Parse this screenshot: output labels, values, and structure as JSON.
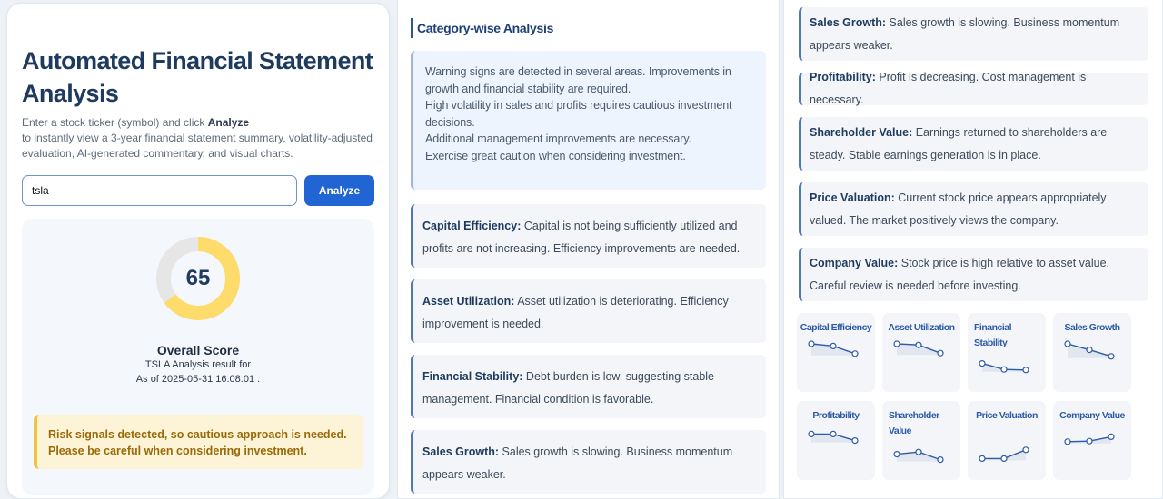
{
  "app": {
    "title": "Automated Financial Statement Analysis",
    "desc_line1_prefix": "Enter a stock ticker (symbol) and click ",
    "desc_line1_bold": "Analyze",
    "desc_line2": "to instantly view a 3-year financial statement summary, volatility-adjusted evaluation, AI-generated commentary, and visual charts."
  },
  "search": {
    "value": "tsla",
    "button_label": "Analyze"
  },
  "score": {
    "value": 65,
    "fraction": 0.65,
    "label": "Overall Score",
    "result_line": "TSLA Analysis result for",
    "as_of": "As of 2025-05-31 16:08:01 .",
    "risk_line1": "Risk signals detected, so cautious approach is needed.",
    "risk_line2": "Please be careful when considering investment.",
    "colors": {
      "fill": "#fddc6c",
      "track": "#e6e6e6"
    }
  },
  "category": {
    "title": "Category-wise Analysis",
    "summary_lines": [
      "Warning signs are detected in several areas. Improvements in growth and financial stability are required.",
      "High volatility in sales and profits requires cautious investment decisions.",
      "Additional management improvements are necessary.",
      "Exercise great caution when considering investment."
    ],
    "items": [
      {
        "label": "Capital Efficiency:",
        "text": "Capital is not being sufficiently utilized and profits are not increasing. Efficiency improvements are needed."
      },
      {
        "label": "Asset Utilization:",
        "text": "Asset utilization is deteriorating. Efficiency improvement is needed."
      },
      {
        "label": "Financial Stability:",
        "text": "Debt burden is low, suggesting stable management. Financial condition is favorable."
      },
      {
        "label": "Sales Growth:",
        "text": "Sales growth is slowing. Business momentum appears weaker."
      }
    ]
  },
  "right_items": [
    {
      "label": "Sales Growth:",
      "text": "Sales growth is slowing. Business momentum appears weaker."
    },
    {
      "label": "Profitability:",
      "text": "Profit is decreasing. Cost management is necessary."
    },
    {
      "label": "Shareholder Value:",
      "text": "Earnings returned to shareholders are steady. Stable earnings generation is in place."
    },
    {
      "label": "Price Valuation:",
      "text": "Current stock price appears appropriately valued. The market positively views the company."
    },
    {
      "label": "Company Value:",
      "text": "Stock price is high relative to asset value. Careful review is needed before investing."
    }
  ],
  "sparks": [
    {
      "title": "Capital Efficiency",
      "values": [
        3,
        2.6,
        1.2
      ]
    },
    {
      "title": "Asset Utilization",
      "values": [
        3,
        2.8,
        1.3
      ]
    },
    {
      "title": "Financial Stability",
      "values": [
        2.4,
        1.3,
        1.2
      ]
    },
    {
      "title": "Sales Growth",
      "values": [
        3,
        1.9,
        0.7
      ]
    },
    {
      "title": "Profitability",
      "values": [
        2.6,
        2.6,
        1.4
      ]
    },
    {
      "title": "Shareholder Value",
      "values": [
        1.9,
        2.3,
        0.9
      ]
    },
    {
      "title": "Price Valuation",
      "values": [
        1.1,
        1.1,
        2.7
      ]
    },
    {
      "title": "Company Value",
      "values": [
        1.2,
        1.3,
        2.1
      ]
    }
  ],
  "colors": {
    "accent": "#2164d3",
    "spark_line": "#2d5aa6",
    "spark_fill": "#dde3ec"
  }
}
